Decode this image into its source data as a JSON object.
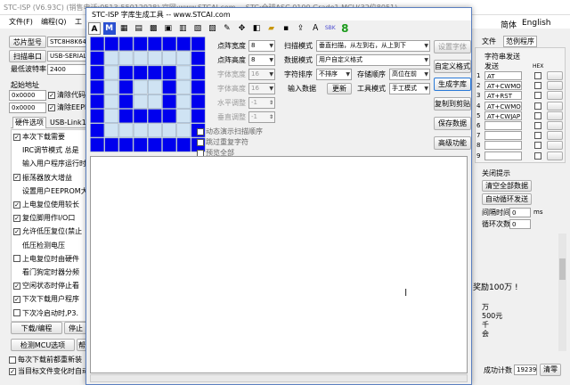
{
  "main_title": "STC-ISP (V6.93C) (销售电话:0513-55012928) 官网:www.STCAI.com  ---STC:全球ASC 0100 Grade1 MCU(32位8051)",
  "main_menu": [
    "文件(F)",
    "编程(Q)",
    "工"
  ],
  "right_menu": [
    "简体",
    "English"
  ],
  "left": {
    "chip_label": "芯片型号",
    "chip_value": "STC8H8K64U",
    "scan_button": "扫描串口",
    "port_value": "USB-SERIAL",
    "baud_label": "最低波特率",
    "baud_value": "2400",
    "start_addr_label": "起始地址",
    "addr1": "0x0000",
    "addr2": "0x0000",
    "clear_code": "清除代码",
    "clear_eeprom": "清除EEPR",
    "tabs": [
      "硬件选项",
      "USB-Link1"
    ],
    "options": [
      {
        "checked": true,
        "text": "本次下载需要",
        "x": 8,
        "y": 0
      },
      {
        "checked": null,
        "text": "IRC调节模式  总是",
        "x": 18,
        "y": 1
      },
      {
        "checked": null,
        "text": "输入用户程序运行时的",
        "x": 8,
        "y": 2
      },
      {
        "checked": true,
        "text": "振荡器放大增益",
        "x": 8,
        "y": 3
      },
      {
        "checked": null,
        "text": "设置用户EEPROM大小",
        "x": 18,
        "y": 4
      },
      {
        "checked": true,
        "text": "上电复位使用较长",
        "x": 8,
        "y": 5
      },
      {
        "checked": true,
        "text": "复位脚用作I/O口",
        "x": 8,
        "y": 6
      },
      {
        "checked": true,
        "text": "允许低压复位(禁止",
        "x": 8,
        "y": 7
      },
      {
        "checked": null,
        "text": "低压检测电压",
        "x": 18,
        "y": 8
      },
      {
        "checked": false,
        "text": "上电复位时由硬件",
        "x": 8,
        "y": 9
      },
      {
        "checked": null,
        "text": "看门狗定时器分频",
        "x": 18,
        "y": 10
      },
      {
        "checked": true,
        "text": "空闲状态时停止看",
        "x": 8,
        "y": 11
      },
      {
        "checked": true,
        "text": "下次下载用户程序",
        "x": 8,
        "y": 12
      },
      {
        "checked": false,
        "text": "下次冷启动时,P3.",
        "x": 8,
        "y": 13
      }
    ],
    "download_button": "下载/编程",
    "stop_button": "停止",
    "detect_button": "检测MCU选项",
    "help_button": "帮",
    "bottom_check1": "每次下载前都重新装",
    "bottom_check2": "当目标文件变化时自动"
  },
  "right": {
    "tabs": [
      "文件",
      "范例程序"
    ],
    "send_title": "字符串发送",
    "send_label": "发送",
    "hex_label": "HEX",
    "send_rows": [
      "AT",
      "AT+CWMODE",
      "AT+RST",
      "AT+CWMODE",
      "AT+CWJAP"
    ],
    "close_tip": "关闭提示",
    "clear_all_button": "清空全部数据",
    "auto_send_button": "自动循环发送",
    "interval_label": "间隔时间",
    "interval_value": "0",
    "interval_unit": "ms",
    "cycle_label": "循环次数",
    "cycle_value": "0",
    "prize_text": "奖励100万 !",
    "lines": [
      "万",
      "500元",
      "千",
      "会"
    ],
    "success_label": "成功计数",
    "success_value": "19239",
    "clear_button": "清零"
  },
  "tool": {
    "title": "STC-ISP 字库生成工具 -- www.STCAI.com",
    "toolbar_green_number": "8",
    "grid_colors": {
      "on": "#0000ee",
      "off": "#cfe3f3"
    },
    "grid_rows": [
      "11111111",
      "10000001",
      "10111101",
      "10100101",
      "10100101",
      "10111101",
      "10000001",
      "11111111"
    ],
    "dot_width_label": "点阵宽度",
    "dot_width_value": "8",
    "dot_height_label": "点阵高度",
    "dot_height_value": "8",
    "font_width_label": "字体宽度",
    "font_width_value": "16",
    "font_height_label": "字体高度",
    "font_height_value": "16",
    "h_adjust_label": "水平调整",
    "h_adjust_value": "-1",
    "v_adjust_label": "垂直调整",
    "v_adjust_value": "-1",
    "anim_check": "动态演示扫描顺序",
    "skip_check": "跳过重复字符",
    "preview_check": "预览全部",
    "scan_mode_label": "扫描模式",
    "scan_mode_value": "垂直扫描，从左到右，从上到下",
    "data_mode_label": "数据模式",
    "data_mode_value": "用户自定义格式",
    "char_order_label": "字符排序",
    "char_order_value": "不排序",
    "storage_label": "存储顺序",
    "storage_value": "高位在前",
    "input_label": "输入数据",
    "update_button": "更新",
    "tool_mode_label": "工具模式",
    "tool_mode_value": "手工模式",
    "side_buttons": [
      "设置字体",
      "自定义格式",
      "生成字库",
      "复制到剪贴板",
      "保存数据",
      "高级功能"
    ]
  }
}
